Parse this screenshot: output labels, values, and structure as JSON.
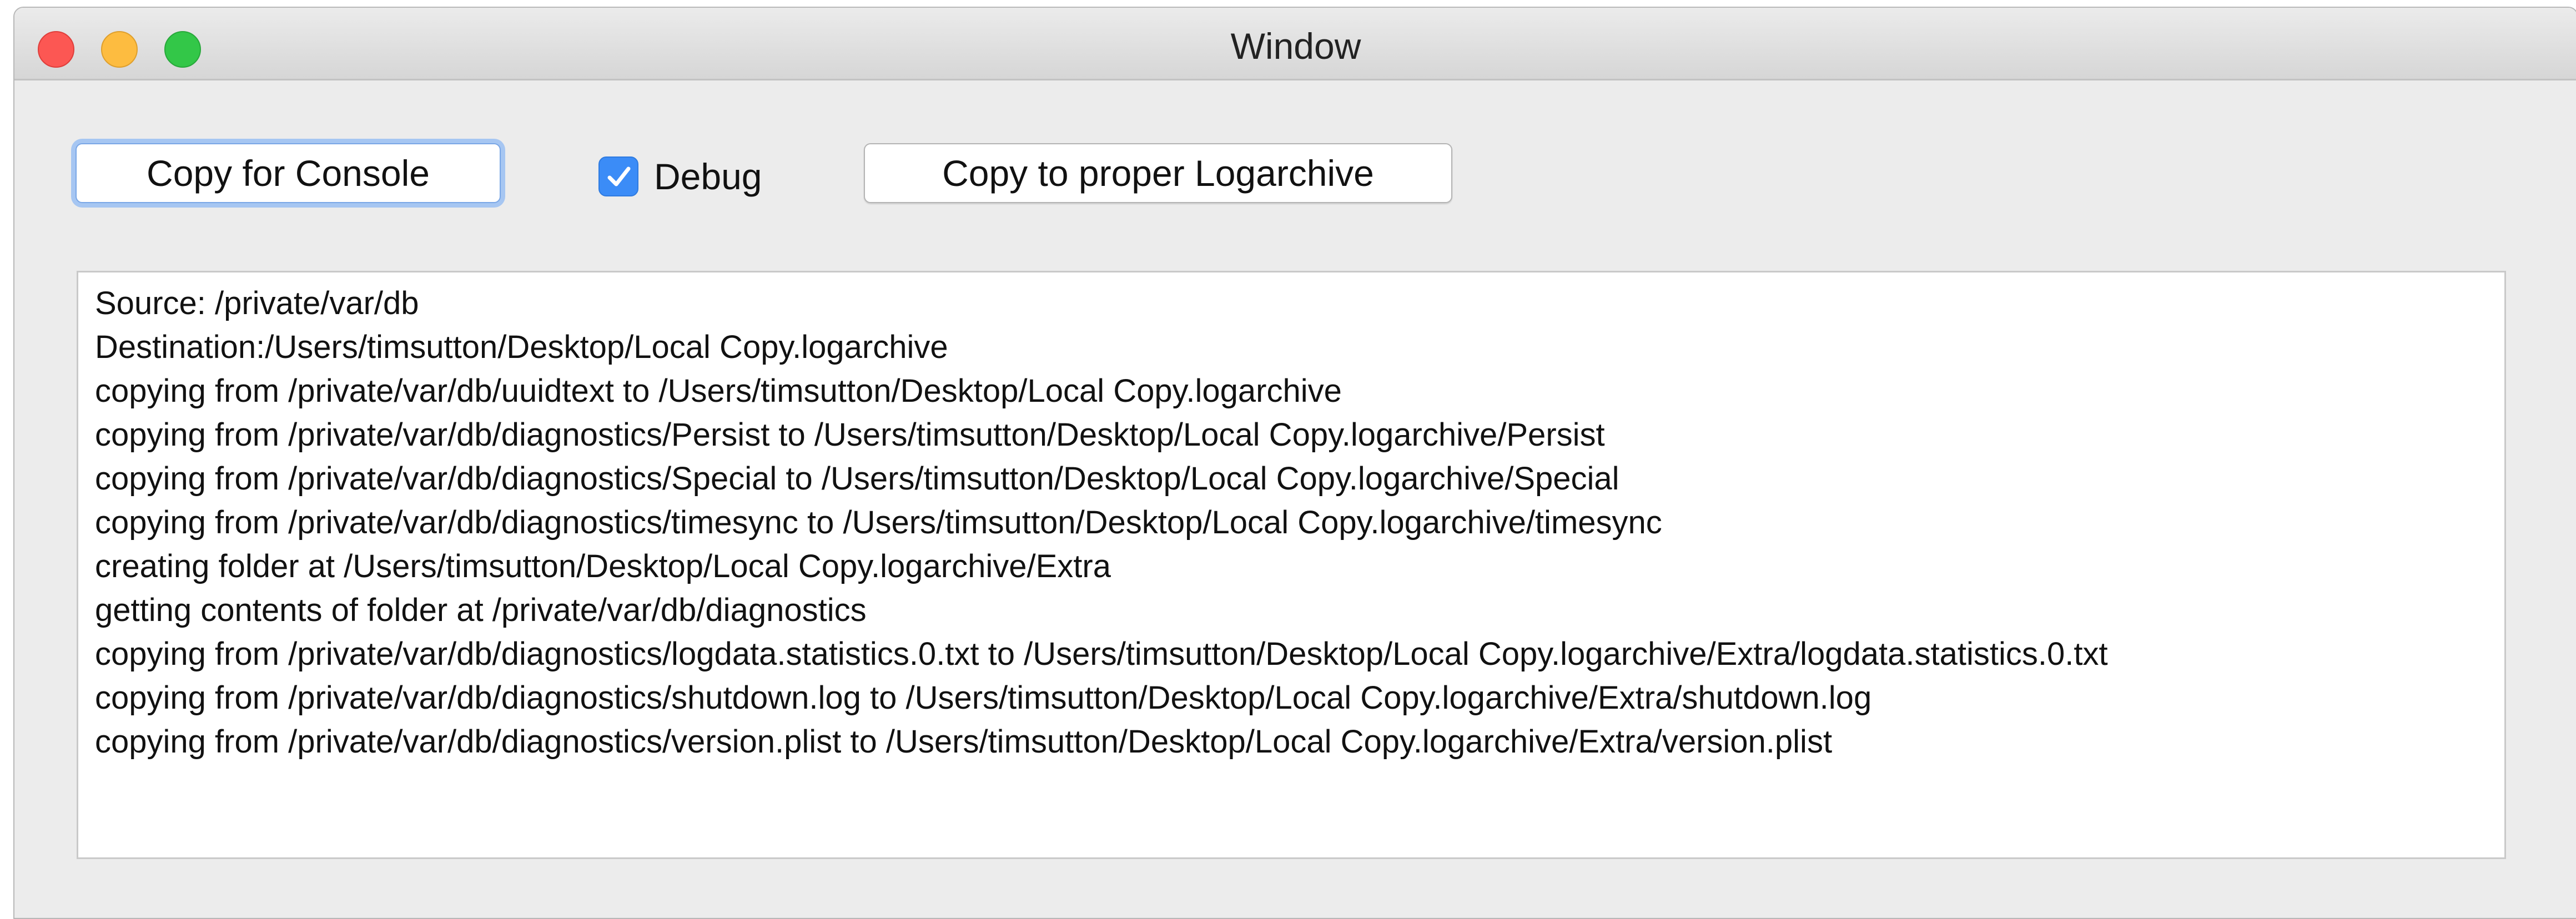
{
  "window": {
    "title": "Window"
  },
  "toolbar": {
    "copy_console_label": "Copy for Console",
    "debug_label": "Debug",
    "debug_checked": true,
    "copy_logarchive_label": "Copy to proper Logarchive"
  },
  "log": {
    "lines": [
      "Source: /private/var/db",
      "Destination:/Users/timsutton/Desktop/Local Copy.logarchive",
      "copying from /private/var/db/uuidtext to /Users/timsutton/Desktop/Local Copy.logarchive",
      "copying from /private/var/db/diagnostics/Persist to /Users/timsutton/Desktop/Local Copy.logarchive/Persist",
      "copying from /private/var/db/diagnostics/Special to /Users/timsutton/Desktop/Local Copy.logarchive/Special",
      "copying from /private/var/db/diagnostics/timesync to /Users/timsutton/Desktop/Local Copy.logarchive/timesync",
      "creating folder at /Users/timsutton/Desktop/Local Copy.logarchive/Extra",
      "getting contents of folder at /private/var/db/diagnostics",
      "copying from /private/var/db/diagnostics/logdata.statistics.0.txt to /Users/timsutton/Desktop/Local Copy.logarchive/Extra/logdata.statistics.0.txt",
      "copying from /private/var/db/diagnostics/shutdown.log to /Users/timsutton/Desktop/Local Copy.logarchive/Extra/shutdown.log",
      "copying from /private/var/db/diagnostics/version.plist to /Users/timsutton/Desktop/Local Copy.logarchive/Extra/version.plist"
    ]
  },
  "colors": {
    "accent": "#3b8cf7",
    "focus_ring": "#a6c6f2"
  }
}
